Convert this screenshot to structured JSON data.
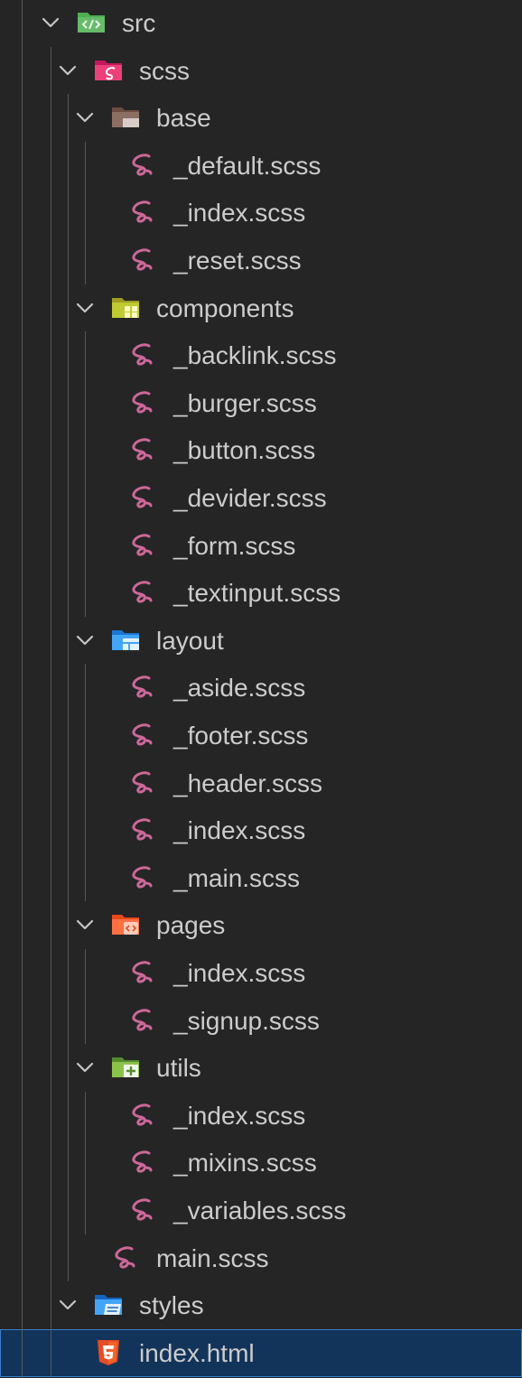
{
  "explorer": {
    "selected": "index.html",
    "items": [
      {
        "label": "src",
        "type": "folder",
        "icon": "folder-src-icon",
        "expanded": true,
        "depth": 0
      },
      {
        "label": "scss",
        "type": "folder",
        "icon": "folder-sass-icon",
        "expanded": true,
        "depth": 1
      },
      {
        "label": "base",
        "type": "folder",
        "icon": "folder-base-icon",
        "expanded": true,
        "depth": 2
      },
      {
        "label": "_default.scss",
        "type": "file",
        "icon": "sass-file-icon",
        "depth": 3
      },
      {
        "label": "_index.scss",
        "type": "file",
        "icon": "sass-file-icon",
        "depth": 3
      },
      {
        "label": "_reset.scss",
        "type": "file",
        "icon": "sass-file-icon",
        "depth": 3
      },
      {
        "label": "components",
        "type": "folder",
        "icon": "folder-components-icon",
        "expanded": true,
        "depth": 2
      },
      {
        "label": "_backlink.scss",
        "type": "file",
        "icon": "sass-file-icon",
        "depth": 3
      },
      {
        "label": "_burger.scss",
        "type": "file",
        "icon": "sass-file-icon",
        "depth": 3
      },
      {
        "label": "_button.scss",
        "type": "file",
        "icon": "sass-file-icon",
        "depth": 3
      },
      {
        "label": "_devider.scss",
        "type": "file",
        "icon": "sass-file-icon",
        "depth": 3
      },
      {
        "label": "_form.scss",
        "type": "file",
        "icon": "sass-file-icon",
        "depth": 3
      },
      {
        "label": "_textinput.scss",
        "type": "file",
        "icon": "sass-file-icon",
        "depth": 3
      },
      {
        "label": "layout",
        "type": "folder",
        "icon": "folder-layout-icon",
        "expanded": true,
        "depth": 2
      },
      {
        "label": "_aside.scss",
        "type": "file",
        "icon": "sass-file-icon",
        "depth": 3
      },
      {
        "label": "_footer.scss",
        "type": "file",
        "icon": "sass-file-icon",
        "depth": 3
      },
      {
        "label": "_header.scss",
        "type": "file",
        "icon": "sass-file-icon",
        "depth": 3
      },
      {
        "label": "_index.scss",
        "type": "file",
        "icon": "sass-file-icon",
        "depth": 3
      },
      {
        "label": "_main.scss",
        "type": "file",
        "icon": "sass-file-icon",
        "depth": 3
      },
      {
        "label": "pages",
        "type": "folder",
        "icon": "folder-pages-icon",
        "expanded": true,
        "depth": 2
      },
      {
        "label": "_index.scss",
        "type": "file",
        "icon": "sass-file-icon",
        "depth": 3
      },
      {
        "label": "_signup.scss",
        "type": "file",
        "icon": "sass-file-icon",
        "depth": 3
      },
      {
        "label": "utils",
        "type": "folder",
        "icon": "folder-utils-icon",
        "expanded": true,
        "depth": 2
      },
      {
        "label": "_index.scss",
        "type": "file",
        "icon": "sass-file-icon",
        "depth": 3
      },
      {
        "label": "_mixins.scss",
        "type": "file",
        "icon": "sass-file-icon",
        "depth": 3
      },
      {
        "label": "_variables.scss",
        "type": "file",
        "icon": "sass-file-icon",
        "depth": 3
      },
      {
        "label": "main.scss",
        "type": "file",
        "icon": "sass-file-icon",
        "depth": 2
      },
      {
        "label": "styles",
        "type": "folder",
        "icon": "folder-css-icon",
        "expanded": true,
        "depth": 1
      },
      {
        "label": "index.html",
        "type": "file",
        "icon": "html-file-icon",
        "depth": 1,
        "selected": true
      }
    ]
  },
  "colors": {
    "background": "#252526",
    "text": "#cccccc",
    "selection_bg": "#13345a",
    "selection_border": "#3a7fd0",
    "sass_pink": "#cd6799",
    "html_orange": "#e44d26"
  }
}
